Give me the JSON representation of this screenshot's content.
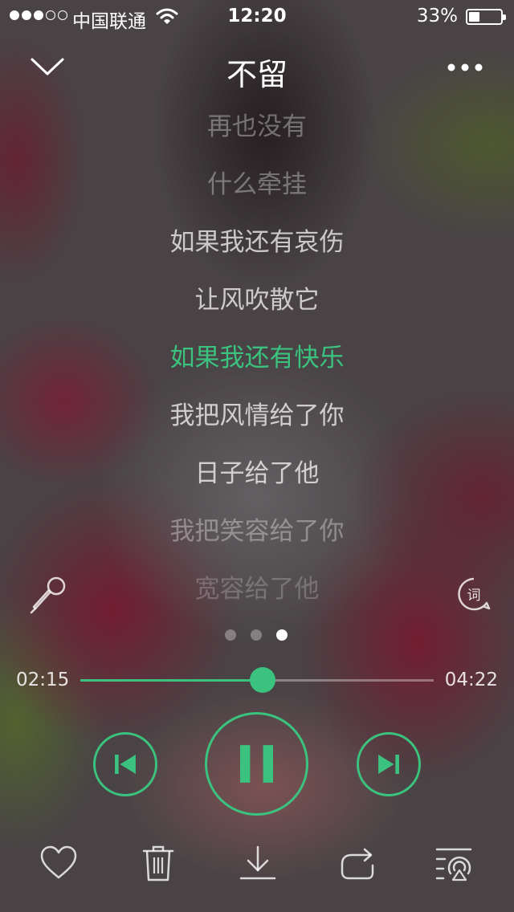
{
  "status_bar": {
    "signal_filled": 3,
    "signal_total": 5,
    "carrier": "中国联通",
    "time": "12:20",
    "battery_percent": "33%",
    "battery_level": 0.33
  },
  "header": {
    "title": "不留",
    "collapse_icon": "chevron-down-icon",
    "more_icon": "more-dots-icon"
  },
  "lyrics": [
    "再也没有",
    "什么牵挂",
    "如果我还有哀伤",
    "让风吹散它",
    "如果我还有快乐",
    "我把风情给了你",
    "日子给了他",
    "我把笑容给了你",
    "宽容给了他"
  ],
  "current_lyric_index": 4,
  "side_icons": {
    "left": "microphone-icon",
    "right": "lyrics-ci-icon"
  },
  "page_indicator": {
    "count": 3,
    "active": 2
  },
  "progress": {
    "elapsed": "02:15",
    "total": "04:22",
    "fraction": 0.515
  },
  "colors": {
    "accent": "#3ac27e"
  },
  "controls": [
    "previous-icon",
    "pause-icon",
    "next-icon"
  ],
  "bottom_bar": [
    "heart-icon",
    "trash-icon",
    "download-icon",
    "share-icon",
    "playlist-airplay-icon"
  ]
}
